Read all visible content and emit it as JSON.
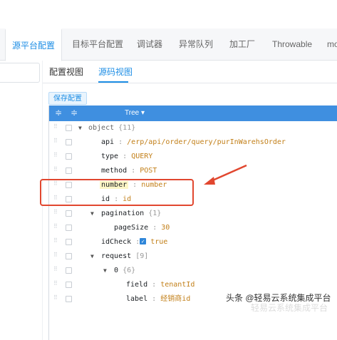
{
  "tabs": [
    {
      "label": "源平台配置",
      "active": true
    },
    {
      "label": "目标平台配置",
      "active": false
    },
    {
      "label": "调试器",
      "active": false
    },
    {
      "label": "异常队列",
      "active": false
    },
    {
      "label": "加工厂",
      "active": false
    },
    {
      "label": "Throwable",
      "active": false
    },
    {
      "label": "mo",
      "active": false
    }
  ],
  "subtabs": [
    {
      "label": "配置视图",
      "active": false
    },
    {
      "label": "源码视图",
      "active": true
    }
  ],
  "save_button": "保存配置",
  "tree_toolbar": {
    "label": "Tree ▾",
    "expand_icon": "≑",
    "collapse_icon": "≑"
  },
  "tree_rows": [
    {
      "key": "object",
      "count": "{11}",
      "expandable": true
    },
    {
      "key": "api",
      "value": "/erp/api/order/query/purInWarehsOrder"
    },
    {
      "key": "type",
      "value": "QUERY"
    },
    {
      "key": "method",
      "value": "POST"
    },
    {
      "key": "number",
      "value": "number",
      "highlight": true
    },
    {
      "key": "id",
      "value": "id"
    },
    {
      "key": "pagination",
      "count": "{1}",
      "expandable": true
    },
    {
      "key": "pageSize",
      "value": "30"
    },
    {
      "key": "idCheck",
      "value": "true",
      "checked": true
    },
    {
      "key": "request",
      "count": "[9]",
      "expandable": true
    },
    {
      "key": "0",
      "count": "{6}",
      "expandable": true
    },
    {
      "key": "field",
      "value": "tenantId"
    },
    {
      "key": "label",
      "value": "经销商id"
    }
  ],
  "watermark": "头条 @轻易云系统集成平台",
  "watermark_faint": "轻易云系统集成平台",
  "colors": {
    "accent": "#1e8ee5",
    "toolbar": "#3f8fe0",
    "value": "#c27f18",
    "annotation": "#e1472f"
  }
}
